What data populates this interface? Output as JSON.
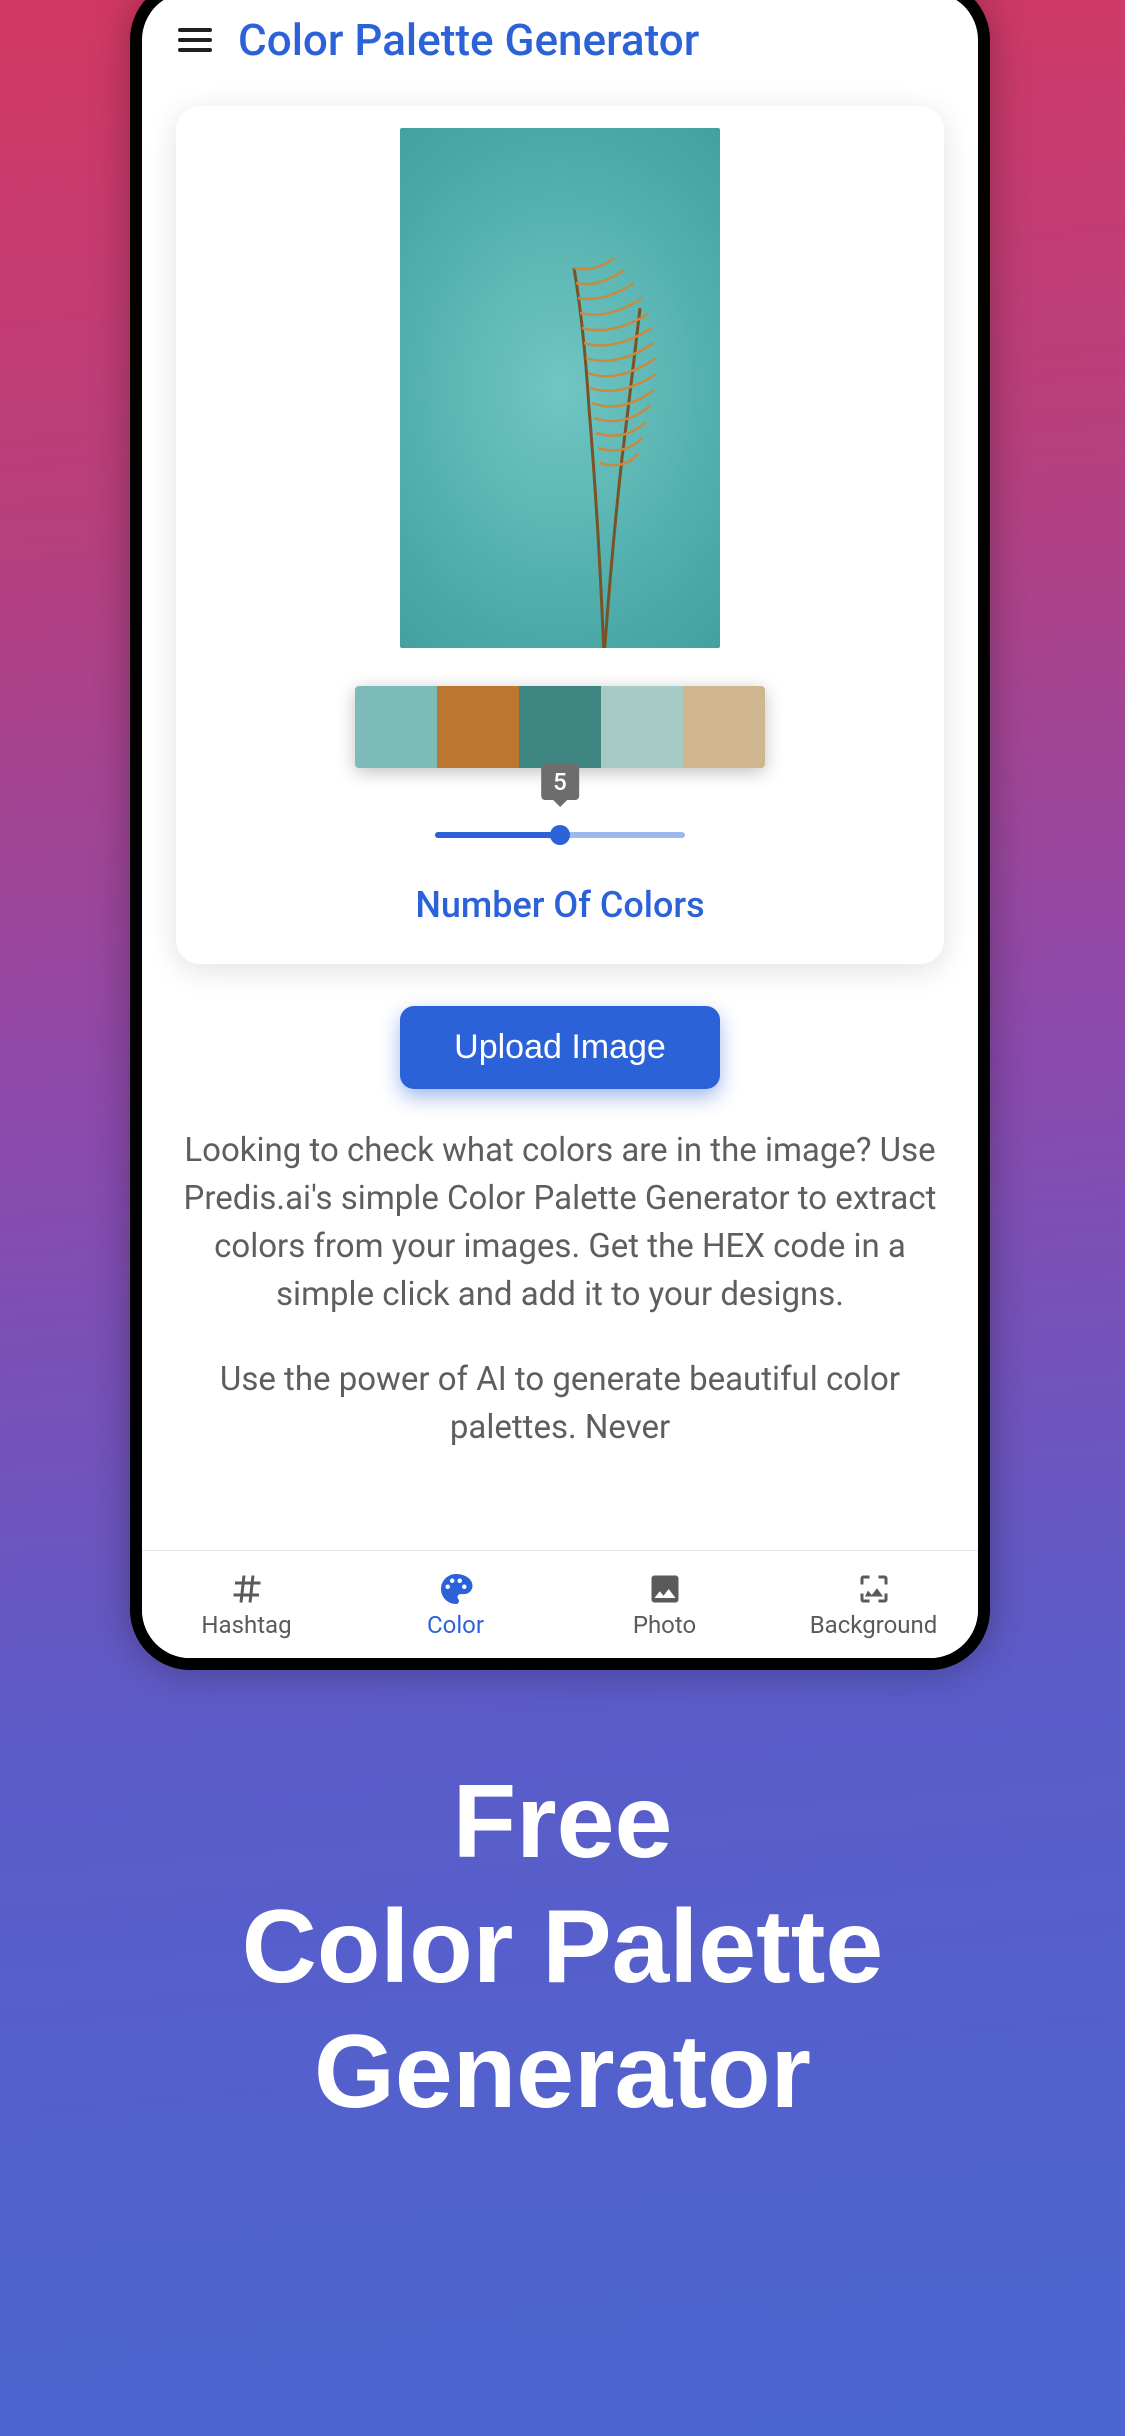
{
  "header": {
    "title": "Color Palette Generator"
  },
  "palette": {
    "swatches": [
      "#7cbbb8",
      "#bd7631",
      "#3e8682",
      "#a7cac5",
      "#cfb68f"
    ],
    "slider_value": "5",
    "label": "Number Of Colors"
  },
  "upload_button": "Upload Image",
  "description": {
    "p1": "Looking to check what colors are in the image? Use Predis.ai's simple Color Palette Generator to extract colors from your images. Get the HEX code in a simple click and add it to your designs.",
    "p2": "Use the power of AI to generate beautiful color palettes. Never"
  },
  "tabs": {
    "hashtag": "Hashtag",
    "color": "Color",
    "photo": "Photo",
    "background": "Background"
  },
  "promo": {
    "line1": "Free",
    "line2": "Color Palette",
    "line3": "Generator"
  }
}
